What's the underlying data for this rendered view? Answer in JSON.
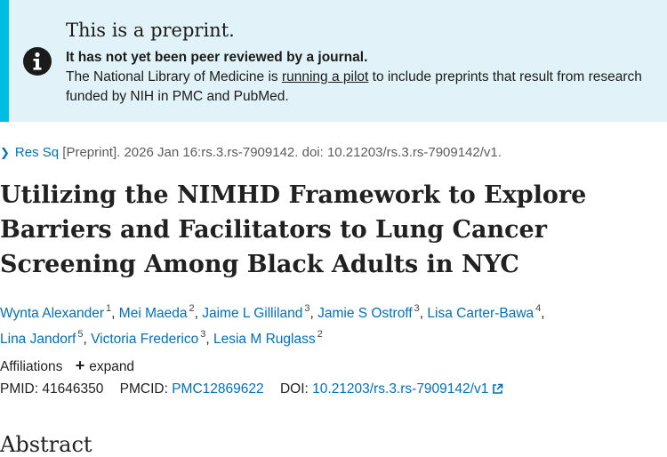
{
  "banner": {
    "heading": "This is a preprint.",
    "bold_line": "It has not yet been peer reviewed by a journal.",
    "text_before_link": "The National Library of Medicine is ",
    "link_text": "running a pilot",
    "text_after_link": " to include preprints that result from research funded by NIH in PMC and PubMed."
  },
  "citation": {
    "source_link": "Res Sq",
    "details": " [Preprint]. 2026 Jan 16:rs.3.rs-7909142. doi: 10.21203/rs.3.rs-7909142/v1."
  },
  "article": {
    "title": "Utilizing the NIMHD Framework to Explore Barriers and Facilitators to Lung Cancer Screening Among Black Adults in NYC"
  },
  "authors": [
    {
      "name": "Wynta Alexander",
      "aff": "1"
    },
    {
      "name": "Mei Maeda",
      "aff": "2"
    },
    {
      "name": "Jaime L Gilliland",
      "aff": "3"
    },
    {
      "name": "Jamie S Ostroff",
      "aff": "3"
    },
    {
      "name": "Lisa Carter-Bawa",
      "aff": "4"
    },
    {
      "name": "Lina Jandorf",
      "aff": "5"
    },
    {
      "name": "Victoria Frederico",
      "aff": "3"
    },
    {
      "name": "Lesia M Ruglass",
      "aff": "2"
    }
  ],
  "affiliations": {
    "label": "Affiliations",
    "expand_label": "expand"
  },
  "identifiers": {
    "pmid_label": "PMID:",
    "pmid": "41646350",
    "pmcid_label": "PMCID:",
    "pmcid": "PMC12869622",
    "doi_label": "DOI:",
    "doi": "10.21203/rs.3.rs-7909142/v1"
  },
  "abstract_heading": "Abstract",
  "colors": {
    "banner_bg": "#e1f3f8",
    "banner_accent": "#00bde3",
    "link": "#0071bc"
  }
}
